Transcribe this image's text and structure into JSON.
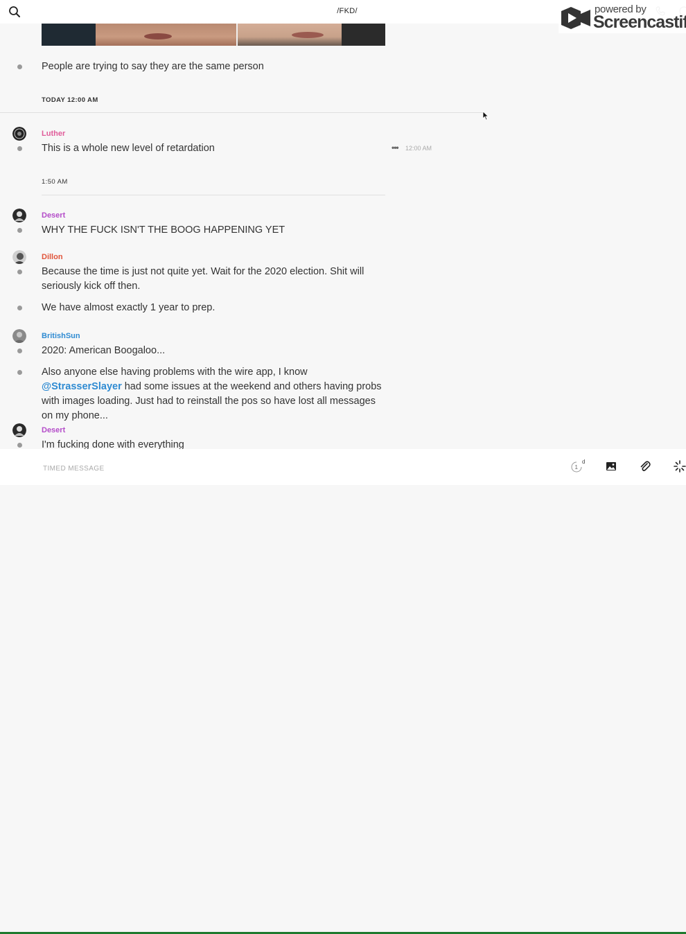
{
  "header": {
    "conversation_title": "/FKD/",
    "search_icon": "search-icon",
    "call_icon": "phone-icon",
    "info_icon": "info-icon"
  },
  "watermark": {
    "powered_by": "powered by",
    "brand": "Screencastify"
  },
  "messages": {
    "m1": {
      "text": "People are trying to say they are the same person"
    },
    "separator_1": "TODAY 12:00 AM",
    "luther": {
      "sender": "Luther",
      "sender_color": "#e05c9a",
      "text": "This is a whole new level of retardation",
      "menu": "•••",
      "time": "12:00 AM"
    },
    "separator_2": "1:50 AM",
    "desert_1": {
      "sender": "Desert",
      "sender_color": "#b44dc9",
      "text": "WHY THE FUCK ISN'T THE BOOG HAPPENING YET"
    },
    "dillon": {
      "sender": "Dillon",
      "sender_color": "#e0543a",
      "text_1": "Because the time is just not quite yet. Wait for the 2020 election. Shit will seriously kick off then.",
      "text_2": "We have almost exactly 1 year to prep."
    },
    "britishsun": {
      "sender": "BritishSun",
      "sender_color": "#2f8bd2",
      "text_1": "2020: American Boogaloo...",
      "text_2_before": "Also anyone else having problems with the wire app, I know ",
      "mention": "@StrasserSlayer",
      "text_2_after": " had some issues at the weekend and others having probs with images loading.  Just had to reinstall the pos so have lost all messages on my phone..."
    },
    "desert_2": {
      "sender": "Desert",
      "sender_color": "#b44dc9",
      "text": "I'm fucking done with everything"
    }
  },
  "composer": {
    "placeholder": "TIMED MESSAGE",
    "timer_value": "1",
    "timer_unit": "d",
    "image_icon": "image-icon",
    "attach_icon": "paperclip-icon",
    "gif_icon": "gif-icon"
  }
}
